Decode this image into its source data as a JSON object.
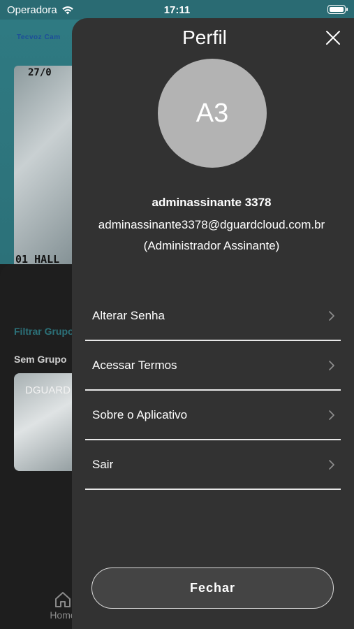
{
  "status_bar": {
    "carrier": "Operadora",
    "time": "17:11"
  },
  "background": {
    "logo": "Tecvoz Cam",
    "camera1_date": "27/0",
    "camera1_label": "01 HALL",
    "filter_label": "Filtrar Grupo",
    "group_label": "Sem Grupo",
    "camera2_brand": "DGUARD",
    "nav_home": "Home"
  },
  "profile": {
    "title": "Perfil",
    "avatar_initials": "A3",
    "name": "adminassinante 3378",
    "email": "adminassinante3378@dguardcloud.com.br",
    "role": "(Administrador Assinante)",
    "menu": [
      {
        "label": "Alterar Senha"
      },
      {
        "label": "Acessar Termos"
      },
      {
        "label": "Sobre o Aplicativo"
      },
      {
        "label": "Sair"
      }
    ],
    "close_button": "Fechar"
  },
  "colors": {
    "panel_bg": "#323232",
    "header_teal": "#2c7179",
    "avatar_bg": "#b3b3b3",
    "divider": "#e8e8e8"
  }
}
